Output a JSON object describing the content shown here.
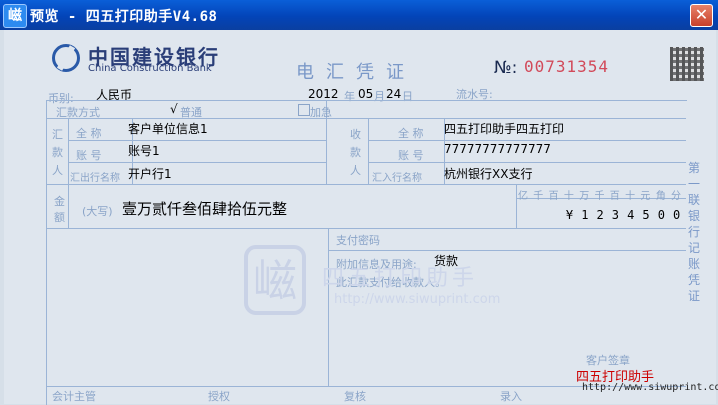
{
  "window": {
    "title": "预览 - 四五打印助手V4.68",
    "close_glyph": "✕"
  },
  "bank": {
    "name_cn": "中国建设银行",
    "name_en": "China Construction Bank"
  },
  "voucher": {
    "title": "电汇凭证",
    "no_label": "№:",
    "serial": "00731354",
    "currency_label": "币别:",
    "currency": "人民币",
    "date_year": "2012",
    "date_month": "05",
    "date_day": "24",
    "date_labels": {
      "year": "年",
      "month": "月",
      "day": "日"
    },
    "serial_label": "流水号:",
    "method_label": "汇款方式",
    "method_normal": "普通",
    "method_normal_mark": "√",
    "method_urgent": "加急",
    "payer_group": "汇款人",
    "payee_group": "收款人",
    "payer": {
      "name_label": "全 称",
      "name": "客户单位信息1",
      "account_label": "账 号",
      "account": "账号1",
      "bank_label": "汇出行名称",
      "bank": "开户行1"
    },
    "payee": {
      "name_label": "全 称",
      "name": "四五打印助手四五打印",
      "account_label": "账 号",
      "account": "77777777777777",
      "bank_label": "汇入行名称",
      "bank": "杭州银行XX支行"
    },
    "amount_group": "金额",
    "amount_caps_label": "(大写)",
    "amount_caps": "壹万贰仟叁佰肆拾伍元整",
    "amount_units": [
      "亿",
      "千",
      "百",
      "十",
      "万",
      "千",
      "百",
      "十",
      "元",
      "角",
      "分"
    ],
    "amount_digits": [
      "¥",
      "1",
      "2",
      "3",
      "4",
      "5",
      "0",
      "0"
    ],
    "pay_password_label": "支付密码",
    "extra_label": "附加信息及用途:",
    "extra_value": "货款",
    "notice": "此汇款支付给收款人。",
    "customer_sign_label": "客户签章",
    "footer": {
      "supervisor": "会计主管",
      "auth": "授权",
      "review": "复核",
      "entry": "录入"
    },
    "side_label": "第一联 银行记账凭证",
    "stamp_text": "四五打印助手",
    "watermark_url": "http://www.siwuprint.com",
    "bg_watermark_text": "四五打印助手",
    "bg_watermark_url": "http://www.siwuprint.com"
  },
  "colors": {
    "titlebar": "#0a5fd8",
    "serial": "#d24a5a",
    "grid": "#9bb4d6",
    "label": "#8aa4c8"
  }
}
